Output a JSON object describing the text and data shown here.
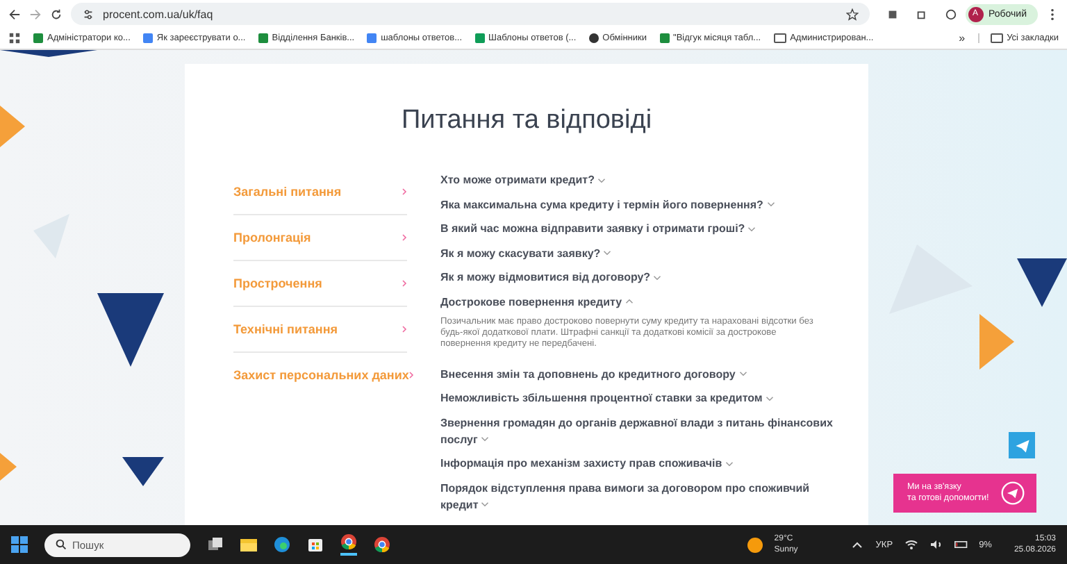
{
  "browser": {
    "url": "procent.com.ua/uk/faq",
    "profile": "Робочий",
    "profile_initial": "A",
    "bookmarks": [
      {
        "label": "Адміністратори ко...",
        "kind": "sheet"
      },
      {
        "label": "Як зареєструвати о...",
        "kind": "doc"
      },
      {
        "label": "Відділення Банків...",
        "kind": "sheet"
      },
      {
        "label": "шаблоны ответов...",
        "kind": "doc"
      },
      {
        "label": "Шаблоны ответов (...",
        "kind": "slides"
      },
      {
        "label": "Обмінники",
        "kind": "globe"
      },
      {
        "label": "\"Відгук місяця табл...",
        "kind": "sheet"
      },
      {
        "label": "Администрирован...",
        "kind": "folder"
      }
    ],
    "more": "»",
    "all_bookmarks": "Усі закладки"
  },
  "page": {
    "title": "Питання та відповіді",
    "categories": [
      {
        "label": "Загальні питання"
      },
      {
        "label": "Пролонгація"
      },
      {
        "label": "Прострочення"
      },
      {
        "label": "Технічні питання"
      },
      {
        "label": "Захист персональних даних"
      }
    ],
    "faq": [
      {
        "question": "Хто може отримати кредит?",
        "expanded": false
      },
      {
        "question": "Яка максимальна сума кредиту і термін його повернення?",
        "expanded": false
      },
      {
        "question": "В який час можна відправити заявку і отримати гроші?",
        "expanded": false
      },
      {
        "question": "Як я можу скасувати заявку?",
        "expanded": false
      },
      {
        "question": "Як я можу відмовитися від договору?",
        "expanded": false
      },
      {
        "question": "Дострокове повернення кредиту",
        "expanded": true,
        "answer": "Позичальник має право достроково повернути суму кредиту та нараховані відсотки без будь-якої додаткової плати. Штрафні санкції та додаткові комісії за дострокове повернення кредиту не передбачені."
      },
      {
        "question": "Внесення змін та доповнень до кредитного договору",
        "expanded": false
      },
      {
        "question": "Неможливість збільшення процентної ставки за кредитом",
        "expanded": false
      },
      {
        "question": "Звернення громадян до органів державної влади з питань фінансових послуг",
        "expanded": false
      },
      {
        "question": "Інформація про механізм захисту прав споживачів",
        "expanded": false
      },
      {
        "question": "Порядок відступлення права вимоги за договором про споживчий кредит",
        "expanded": false
      }
    ],
    "contact": [
      "Ми на зв'язку",
      "та готові допомогти!"
    ]
  },
  "taskbar": {
    "search_placeholder": "Пошук",
    "temperature": "29°C",
    "weather": "Sunny",
    "language": "УКР",
    "battery": "9%",
    "time": "15:03",
    "date": "25.08.2026"
  }
}
